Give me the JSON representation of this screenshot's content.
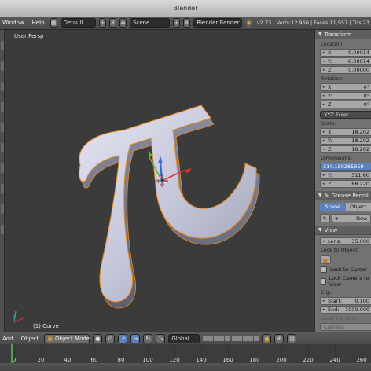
{
  "app": {
    "title": "Blender"
  },
  "info_header": {
    "menus": [
      "Window",
      "Help"
    ],
    "screen_layout": "Default",
    "scene": "Scene",
    "render_engine": "Blender Render",
    "stats": "v2.73 | Verts:12,960 | Faces:11,957 | Tris:23,"
  },
  "viewport": {
    "view_label": "User Persp",
    "object_label": "(1) Curve"
  },
  "properties": {
    "transform": {
      "header": "Transform",
      "location_label": "Location:",
      "location": [
        {
          "axis": "X:",
          "value": "0.00014"
        },
        {
          "axis": "Y:",
          "value": "-0.00014"
        },
        {
          "axis": "Z:",
          "value": "0.00000"
        }
      ],
      "rotation_label": "Rotation:",
      "rotation": [
        {
          "axis": "X:",
          "value": "0°"
        },
        {
          "axis": "Y:",
          "value": "0°"
        },
        {
          "axis": "Z:",
          "value": "0°"
        }
      ],
      "rotation_mode": "XYZ Euler",
      "scale_label": "Scale:",
      "scale": [
        {
          "axis": "X:",
          "value": "18.202"
        },
        {
          "axis": "Y:",
          "value": "18.202"
        },
        {
          "axis": "Z:",
          "value": "18.202"
        }
      ],
      "dimensions_label": "Dimensions:",
      "dimensions": [
        {
          "axis": "",
          "value": "314.159265359"
        },
        {
          "axis": "Y:",
          "value": "311.60"
        },
        {
          "axis": "Z:",
          "value": "68.220"
        }
      ]
    },
    "grease_pencil": {
      "header": "Grease Pencil",
      "tab_scene": "Scene",
      "tab_object": "Object",
      "new_button": "New"
    },
    "view": {
      "header": "View",
      "lens_label": "Lens:",
      "lens_value": "35.000",
      "lock_to_object": "Lock to Object:",
      "lock_to_cursor": "Lock to Cursor",
      "lock_camera": "Lock Camera to View",
      "clip_label": "Clip:",
      "clip_start_label": "Start:",
      "clip_start": "0.100",
      "clip_end_label": "End:",
      "clip_end": "1000.000",
      "local_camera_label": "Local Camera:",
      "local_camera": "Camera"
    }
  },
  "viewport_header": {
    "add": "Add",
    "object": "Object",
    "mode": "Object Mode",
    "orientation": "Global"
  },
  "timeline": {
    "ticks": [
      "0",
      "20",
      "40",
      "60",
      "80",
      "100",
      "120",
      "140",
      "160",
      "180",
      "200",
      "220",
      "240",
      "260"
    ]
  },
  "colors": {
    "viewport_bg": "#3b3b3b",
    "object_color": "#c7c9dc",
    "selection_outline": "#e88a1a",
    "axis_x": "#e0322a",
    "axis_y": "#4fbf32",
    "axis_z": "#3a6ee0"
  },
  "icons": [
    "scene-icon",
    "render-icon",
    "close-icon",
    "plus-icon",
    "pencil-icon",
    "lock-icon",
    "axis-gizmo-icon",
    "cursor-3d-icon"
  ]
}
